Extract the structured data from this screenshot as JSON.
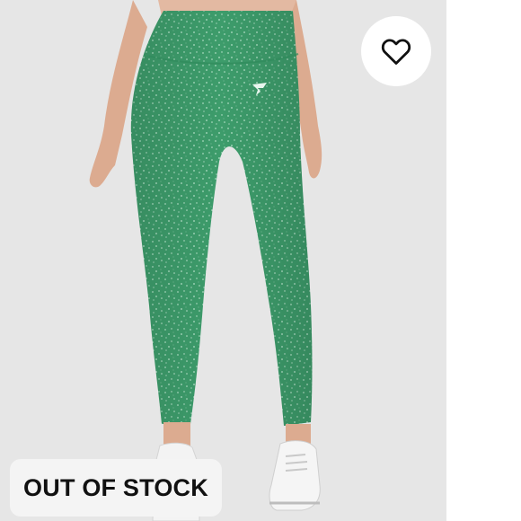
{
  "listing": {
    "stock_status": "OUT OF STOCK",
    "favorite_icon": "heart-outline-icon",
    "brand_logo_icon": "gymshark-logo-icon"
  },
  "colors": {
    "photo_background": "#e6e6e6",
    "leggings_green": "#3f9e6d",
    "badge_background": "#f4f4f4",
    "badge_text": "#111111"
  }
}
